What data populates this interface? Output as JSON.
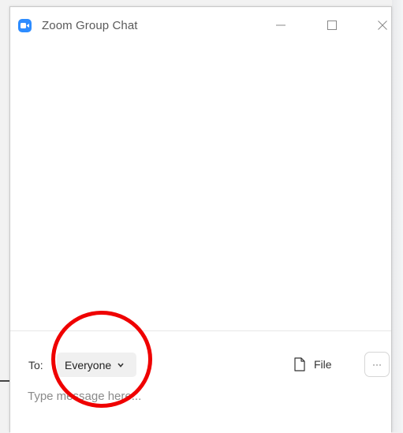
{
  "window": {
    "title": "Zoom Group Chat",
    "app_icon": "zoom-camera-icon",
    "controls": {
      "minimize_icon": "minimize-icon",
      "maximize_icon": "maximize-icon",
      "close_icon": "close-icon"
    }
  },
  "compose": {
    "to_label": "To:",
    "recipient": {
      "selected": "Everyone",
      "icon": "chevron-down-icon"
    },
    "file_button": {
      "label": "File",
      "icon": "file-icon"
    },
    "more_button": {
      "label": "···",
      "icon": "more-options-icon"
    },
    "message_input": {
      "value": "",
      "placeholder": "Type message here..."
    }
  },
  "annotation": {
    "shape": "circle",
    "color": "#ef0000"
  },
  "colors": {
    "accent": "#2d8cff"
  }
}
